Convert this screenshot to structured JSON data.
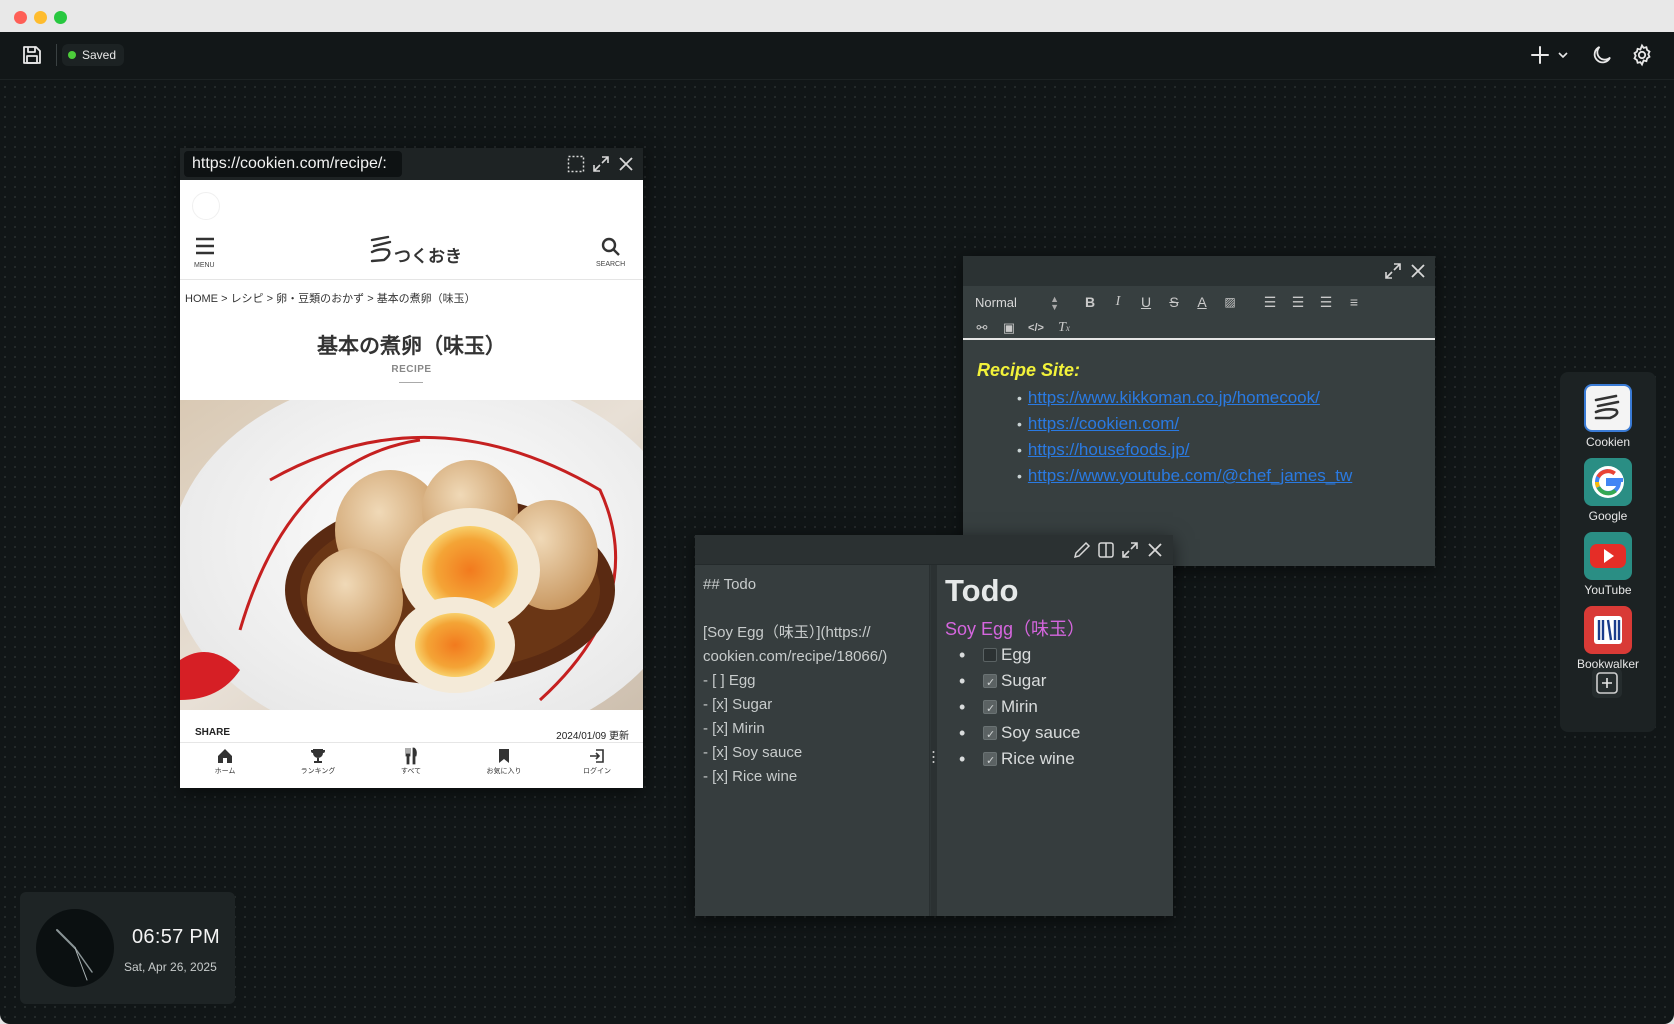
{
  "window": {
    "title": ""
  },
  "topbar": {
    "status_label": "Saved",
    "status_color": "#4ccc3a",
    "icons": [
      "save-icon",
      "plus-icon",
      "chevron-down-icon",
      "moon-icon",
      "gear-icon"
    ]
  },
  "browser": {
    "url": "https://cookien.com/recipe/:",
    "site": {
      "menu_label": "MENU",
      "search_label": "SEARCH",
      "logo_text": "つくおき",
      "breadcrumb": [
        "HOME",
        ">",
        "レシピ",
        ">",
        "卵・豆類のおかず",
        ">",
        "基本の煮卵（味玉）"
      ],
      "title": "基本の煮卵（味玉）",
      "tag": "RECIPE",
      "share_label": "SHARE",
      "updated": "2024/01/09 更新",
      "nav": [
        {
          "icon": "home-icon",
          "label": "ホーム"
        },
        {
          "icon": "trophy-icon",
          "label": "ランキング"
        },
        {
          "icon": "cutlery-icon",
          "label": "すべて"
        },
        {
          "icon": "bookmark-icon",
          "label": "お気に入り"
        },
        {
          "icon": "login-icon",
          "label": "ログイン"
        }
      ]
    }
  },
  "editor": {
    "format_select": "Normal",
    "heading": "Recipe Site:",
    "heading_color": "#f2f23a",
    "links": [
      "https://www.kikkoman.co.jp/homecook/",
      "https://cookien.com/",
      "https://housefoods.jp/",
      "https://www.youtube.com/@chef_james_tw"
    ],
    "link_color": "#2a7ae2",
    "tools": [
      "bold-icon",
      "italic-icon",
      "underline-icon",
      "strike-icon",
      "text-color-icon",
      "highlight-icon",
      "ordered-list-icon",
      "bullet-list-icon",
      "checklist-icon",
      "align-icon",
      "link-icon",
      "image-icon",
      "code-icon",
      "clear-format-icon"
    ]
  },
  "markdown": {
    "source": "## Todo\n\n[Soy Egg（味玉）](https://\ncookien.com/recipe/18066/)\n- [ ] Egg\n- [x] Sugar\n- [x] Mirin\n- [x] Soy sauce\n- [x] Rice wine",
    "preview": {
      "heading": "Todo",
      "link": "Soy Egg（味玉）",
      "link_color": "#d566de",
      "items": [
        {
          "label": "Egg",
          "checked": false
        },
        {
          "label": "Sugar",
          "checked": true
        },
        {
          "label": "Mirin",
          "checked": true
        },
        {
          "label": "Soy sauce",
          "checked": true
        },
        {
          "label": "Rice wine",
          "checked": true
        }
      ]
    }
  },
  "dock": {
    "apps": [
      {
        "name": "Cookien",
        "icon": "cookien-logo-icon"
      },
      {
        "name": "Google",
        "icon": "google-logo-icon"
      },
      {
        "name": "YouTube",
        "icon": "youtube-logo-icon"
      },
      {
        "name": "Bookwalker",
        "icon": "bookwalker-logo-icon"
      }
    ],
    "youtube_color": "#e52d27",
    "bookwalker_color": "#d93a36"
  },
  "clock": {
    "time": "06:57 PM",
    "date": "Sat, Apr 26, 2025"
  }
}
